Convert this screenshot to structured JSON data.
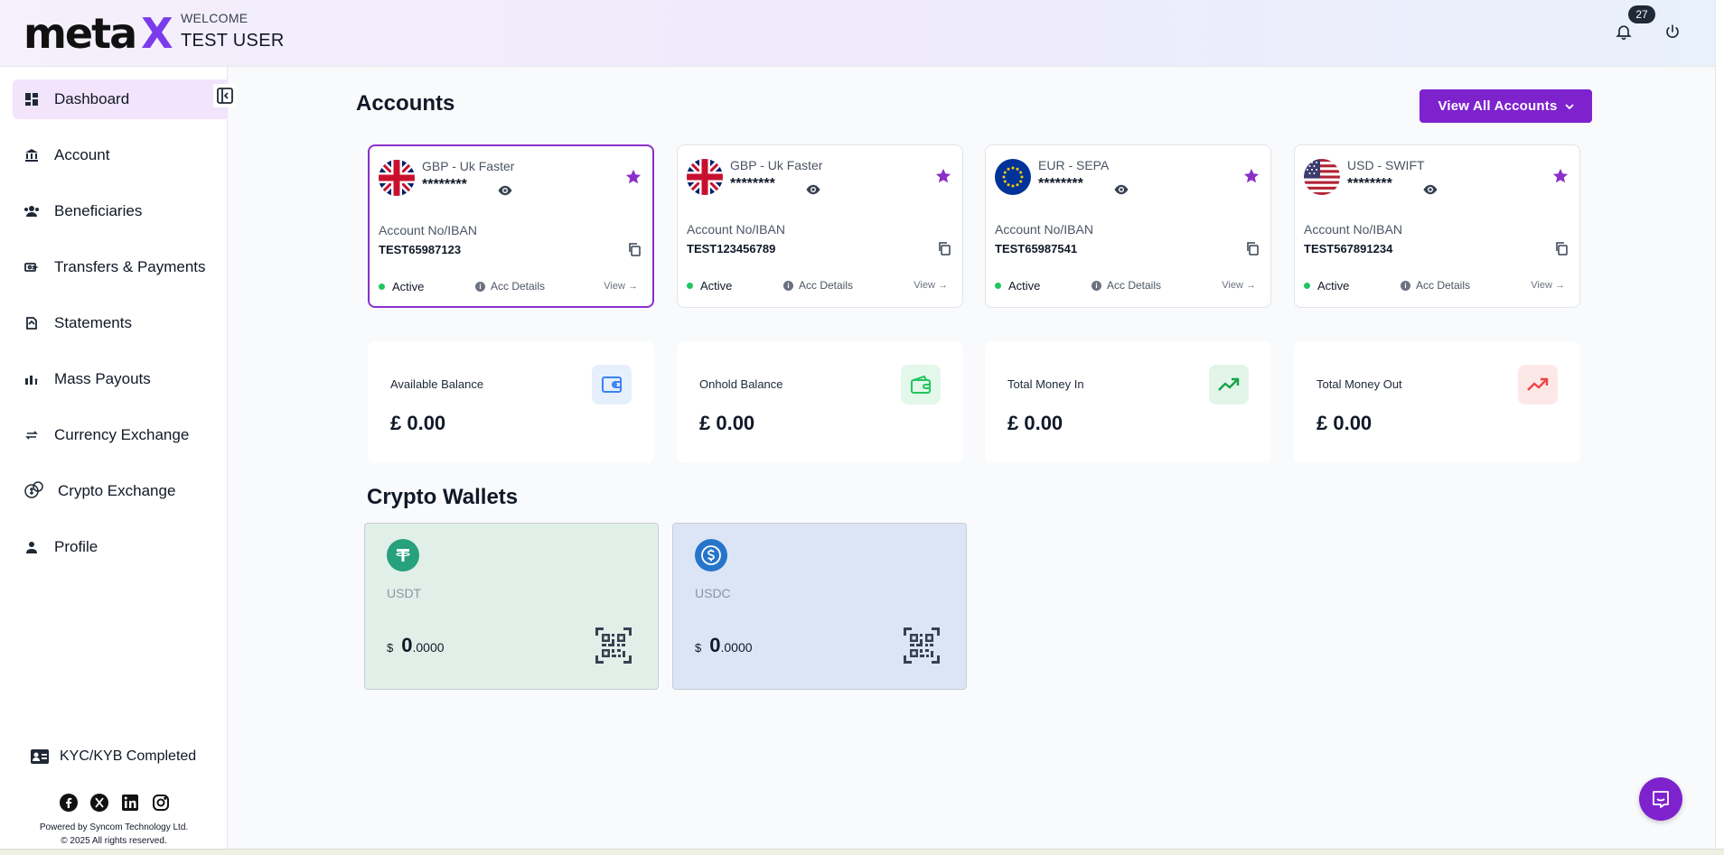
{
  "header": {
    "logo_main": "meta",
    "logo_accent": "X",
    "welcome": "WELCOME",
    "username": "TEST USER",
    "notification_count": "27"
  },
  "sidebar": {
    "items": [
      {
        "label": "Dashboard",
        "icon": "dashboard-icon",
        "active": true
      },
      {
        "label": "Account",
        "icon": "bank-icon"
      },
      {
        "label": "Beneficiaries",
        "icon": "users-icon"
      },
      {
        "label": "Transfers & Payments",
        "icon": "transfer-icon"
      },
      {
        "label": "Statements",
        "icon": "statements-icon"
      },
      {
        "label": "Mass Payouts",
        "icon": "payouts-icon"
      },
      {
        "label": "Currency Exchange",
        "icon": "exchange-icon"
      },
      {
        "label": "Crypto Exchange",
        "icon": "crypto-icon"
      },
      {
        "label": "Profile",
        "icon": "person-icon"
      }
    ],
    "kyc_status": "KYC/KYB Completed",
    "powered_by": "Powered by Syncom Technology Ltd.",
    "copyright": "© 2025 All rights reserved."
  },
  "accounts": {
    "title": "Accounts",
    "view_all_label": "View All Accounts",
    "iban_label": "Account No/IBAN",
    "acc_details_label": "Acc Details",
    "view_label": "View →",
    "cards": [
      {
        "name": "GBP - Uk Faster",
        "mask": "********",
        "number": "TEST65987123",
        "status": "Active",
        "flag": "uk-flag"
      },
      {
        "name": "GBP - Uk Faster",
        "mask": "********",
        "number": "TEST123456789",
        "status": "Active",
        "flag": "uk-flag"
      },
      {
        "name": "EUR - SEPA",
        "mask": "********",
        "number": "TEST65987541",
        "status": "Active",
        "flag": "eu-flag"
      },
      {
        "name": "USD - SWIFT",
        "mask": "********",
        "number": "TEST567891234",
        "status": "Active",
        "flag": "us-flag"
      }
    ]
  },
  "balances": [
    {
      "label": "Available Balance",
      "value": "£ 0.00",
      "icon": "wallet-icon",
      "color": "#3b82f6"
    },
    {
      "label": "Onhold Balance",
      "value": "£ 0.00",
      "icon": "wallet-icon",
      "color": "#22c55e"
    },
    {
      "label": "Total Money In",
      "value": "£ 0.00",
      "icon": "trend-up-icon",
      "color": "#16a34a"
    },
    {
      "label": "Total Money Out",
      "value": "£ 0.00",
      "icon": "trend-up-icon",
      "color": "#ef4444"
    }
  ],
  "crypto": {
    "title": "Crypto Wallets",
    "wallets": [
      {
        "name": "USDT",
        "currency": "$",
        "int": "0",
        "dec": ".0000",
        "icon": "tether-icon"
      },
      {
        "name": "USDC",
        "currency": "$",
        "int": "0",
        "dec": ".0000",
        "icon": "usdc-icon"
      }
    ]
  }
}
